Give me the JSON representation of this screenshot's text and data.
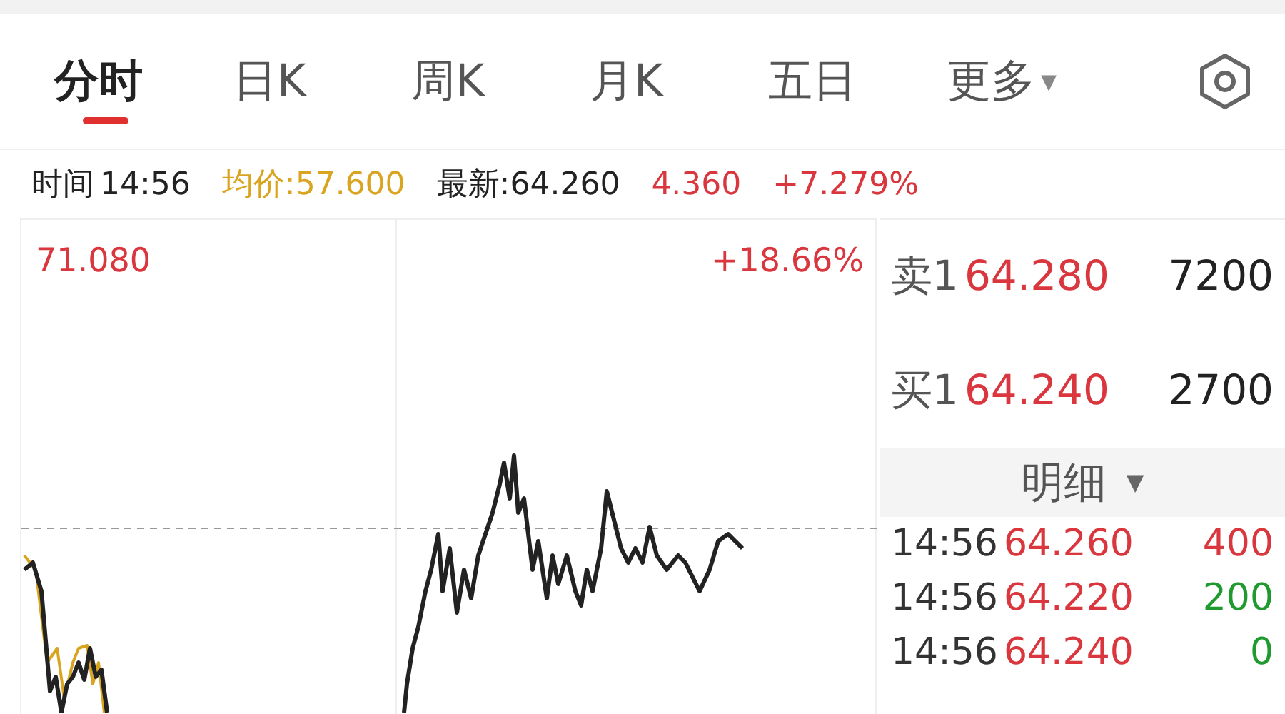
{
  "tabs": [
    {
      "label": "分时",
      "selected": true
    },
    {
      "label": "日K",
      "selected": false
    },
    {
      "label": "周K",
      "selected": false
    },
    {
      "label": "月K",
      "selected": false
    },
    {
      "label": "五日",
      "selected": false
    }
  ],
  "more": {
    "label": "更多",
    "caret": "▾"
  },
  "info": {
    "time_label": "时间",
    "time": "14:56",
    "avg": "均价:57.600",
    "latest": "最新:64.260",
    "change": "4.360",
    "change_pct": "+7.279%"
  },
  "chart": {
    "high": "71.080",
    "high_pct": "+18.66%"
  },
  "quotes": [
    {
      "label": "卖1",
      "price": "64.280",
      "volume": "7200"
    },
    {
      "label": "买1",
      "price": "64.240",
      "volume": "2700"
    }
  ],
  "detail": {
    "title": "明细",
    "caret": "▼"
  },
  "trades": [
    {
      "time": "14:56",
      "price": "64.260",
      "volume": "400",
      "color": "#d9363e"
    },
    {
      "time": "14:56",
      "price": "64.220",
      "volume": "200",
      "color": "#1e9a2e"
    },
    {
      "time": "14:56",
      "price": "64.240",
      "volume": "0",
      "color": "#1e9a2e"
    }
  ]
}
